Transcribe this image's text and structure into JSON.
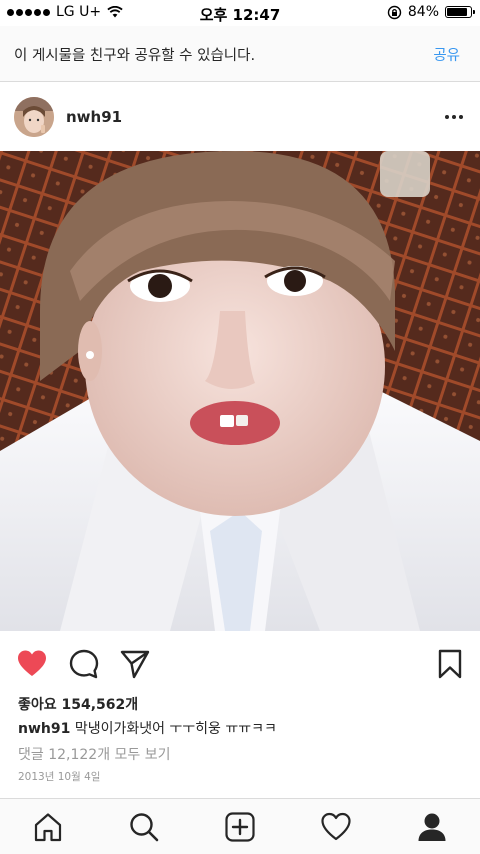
{
  "status_bar": {
    "carrier": "LG U+",
    "time": "오후 12:47",
    "battery": "84%",
    "signal_bars": 5
  },
  "share_banner": {
    "text": "이 게시물을 친구와 공유할 수 있습니다.",
    "button_label": "공유",
    "accent_color": "#3897f0"
  },
  "post": {
    "username": "nwh91",
    "likes_text": "좋아요 154,562개",
    "caption_user": "nwh91",
    "caption_text": "막냉이가화냇어 ㅜㅜ히웅 ㅠㅠㅋㅋ",
    "comments_link": "댓글 12,122개 모두 보기",
    "date": "2013년 10월 4일",
    "liked": true,
    "like_color": "#ed4956"
  },
  "actions": [
    "heart-icon",
    "comment-icon",
    "share-icon",
    "bookmark-icon"
  ],
  "tab_bar": [
    "home-icon",
    "search-icon",
    "add-icon",
    "activity-icon",
    "profile-icon"
  ]
}
